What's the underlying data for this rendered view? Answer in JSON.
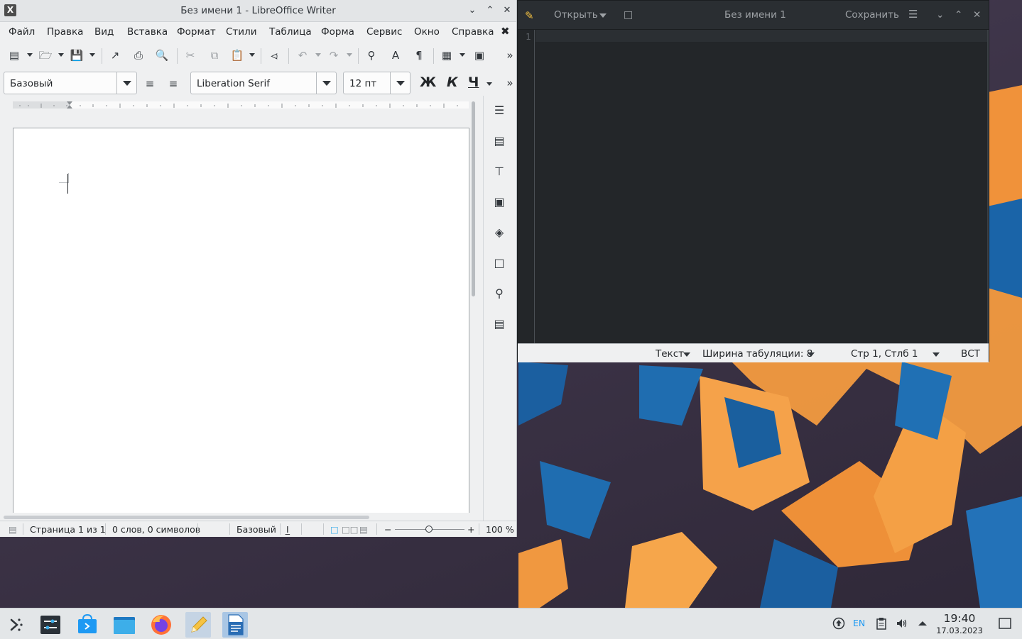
{
  "writer": {
    "title": "Без имени 1 - LibreOffice Writer",
    "app_logo": "X",
    "menu": [
      "Файл",
      "Правка",
      "Вид",
      "Вставка",
      "Формат",
      "Стили",
      "Таблица",
      "Форма",
      "Сервис",
      "Окно",
      "Справка"
    ],
    "paragraph_style": "Базовый",
    "font_name": "Liberation Serif",
    "font_size": "12 пт",
    "bold_label": "Ж",
    "italic_label": "К",
    "underline_label": "Ч",
    "status": {
      "page": "Страница 1 из 1",
      "words": "0 слов, 0 символов",
      "page_style": "Базовый",
      "zoom": "100 %"
    }
  },
  "editor": {
    "open_label": "Открыть",
    "title": "Без имени 1",
    "save_label": "Сохранить",
    "line_number": "1",
    "status": {
      "mode": "Текст",
      "tab_width": "Ширина табуляции: 8",
      "position": "Стр 1, Стлб 1",
      "insert_mode": "ВСТ"
    }
  },
  "taskbar": {
    "language": "EN",
    "time": "19:40",
    "date": "17.03.2023"
  },
  "colors": {
    "accent": "#3daee9",
    "editor_bg": "#232629",
    "wallpaper_orange": "#f09a3e",
    "wallpaper_blue": "#1d6fb5"
  },
  "icons": [
    "app-menu-icon",
    "system-settings-icon",
    "discover-icon",
    "files-icon",
    "firefox-icon",
    "text-editor-icon",
    "writer-icon",
    "updates-icon",
    "clipboard-icon",
    "volume-icon",
    "tray-expand-icon",
    "show-desktop-icon"
  ]
}
